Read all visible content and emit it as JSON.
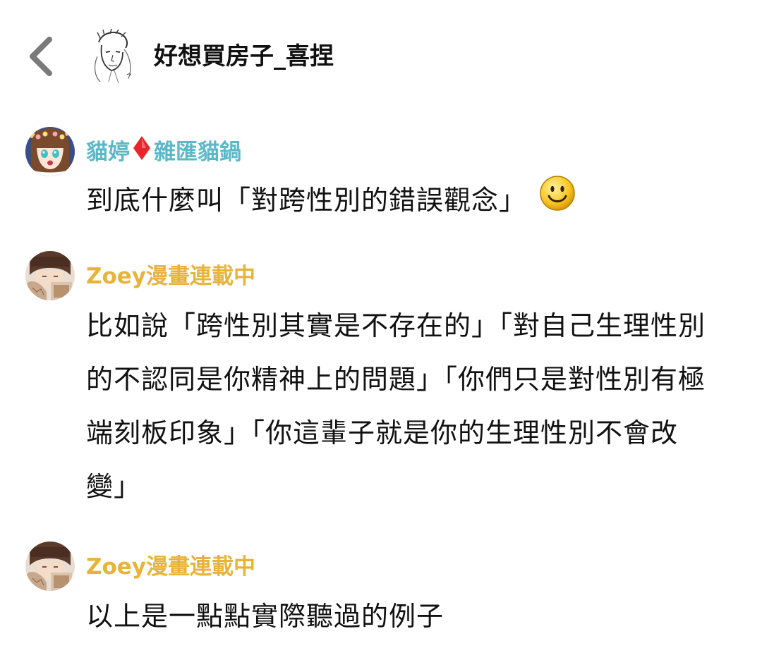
{
  "header": {
    "back_icon": "chevron-left-icon",
    "title": "好想買房子_喜捏"
  },
  "colors": {
    "sender_blue": "#5bb8c9",
    "sender_gold": "#e8b33b",
    "diamond_red": "#e8252a",
    "back_gray": "#7a7a7a"
  },
  "messages": [
    {
      "sender": {
        "name_part1": "貓婷",
        "separator_icon": "red-diamond-icon",
        "name_part2": "雜匯貓鍋"
      },
      "text": "到底什麼叫「對跨性別的錯誤觀念」",
      "emoji": "smiley-face-icon"
    },
    {
      "sender": {
        "name": "Zoey漫畫連載中"
      },
      "text": "比如說「跨性別其實是不存在的」「對自己生理性別的不認同是你精神上的問題」「你們只是對性別有極端刻板印象」「你這輩子就是你的生理性別不會改變」"
    },
    {
      "sender": {
        "name": "Zoey漫畫連載中"
      },
      "text": "以上是一點點實際聽過的例子"
    }
  ]
}
